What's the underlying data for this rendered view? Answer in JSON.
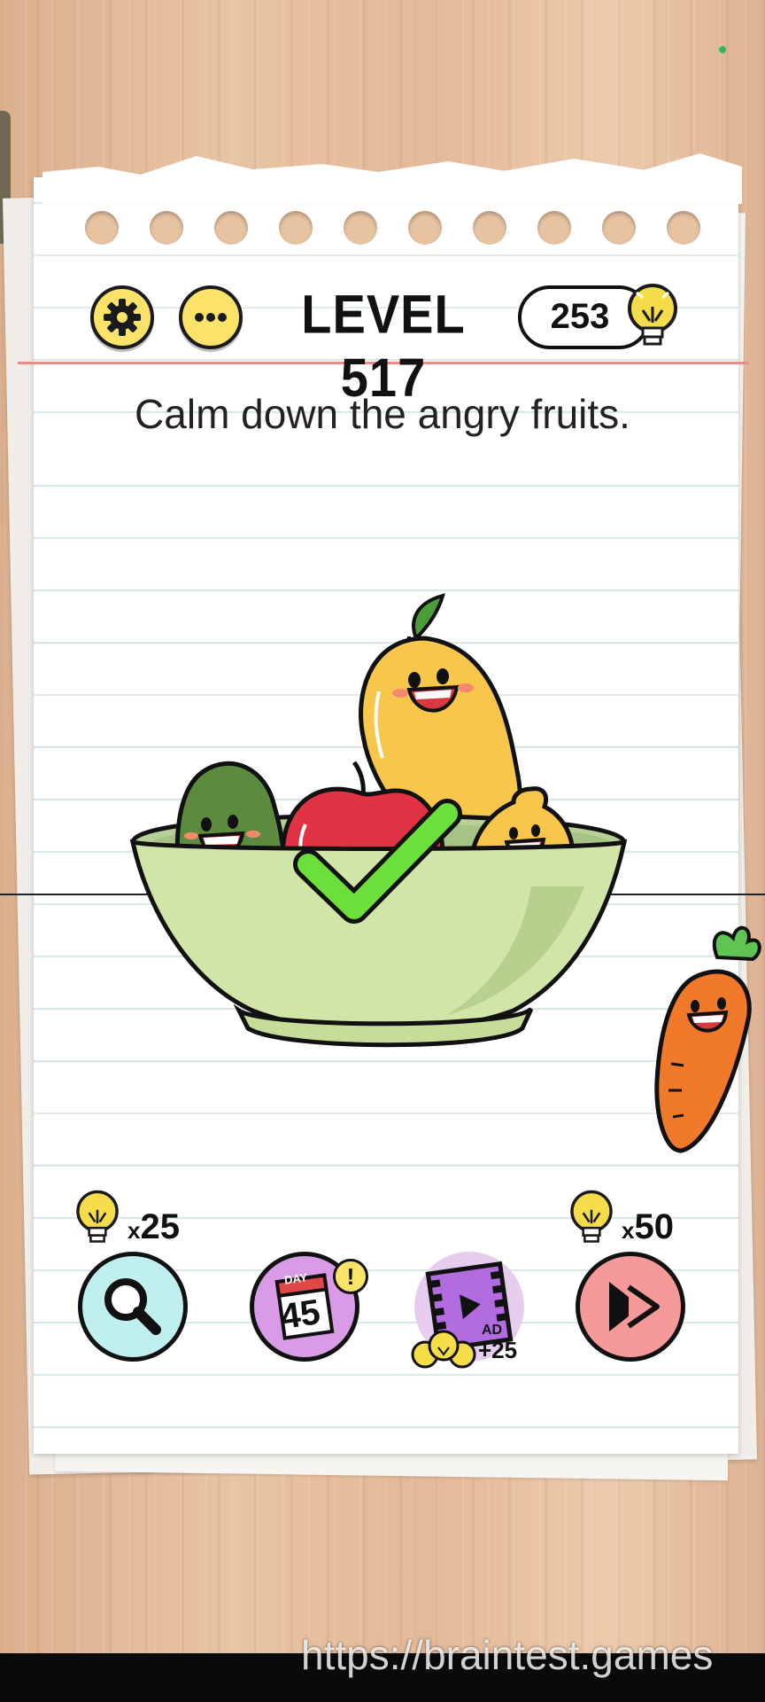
{
  "header": {
    "settings_icon": "gear-icon",
    "menu_icon": "more-dots-icon",
    "level_title": "LEVEL 517",
    "hint_count": "253",
    "hint_icon": "lightbulb-icon"
  },
  "puzzle": {
    "instruction": "Calm down the angry fruits.",
    "result_icon": "checkmark-icon"
  },
  "tools": {
    "search": {
      "icon": "magnifier-icon",
      "cost": "25",
      "cost_prefix": "x"
    },
    "daily": {
      "icon": "calendar-icon",
      "day_label": "DAY",
      "day_number": "45",
      "badge": "!"
    },
    "video_ad": {
      "icon": "film-play-icon",
      "ad_label": "AD",
      "reward": "+25"
    },
    "skip": {
      "icon": "skip-forward-icon",
      "cost": "50",
      "cost_prefix": "x"
    }
  },
  "watermark": "https://braintest.games",
  "colors": {
    "button_yellow": "#fbe36a",
    "check_green": "#6be03a",
    "search_bg": "#bff0ef",
    "daily_bg": "#d99ae6",
    "skip_bg": "#f59a98"
  }
}
